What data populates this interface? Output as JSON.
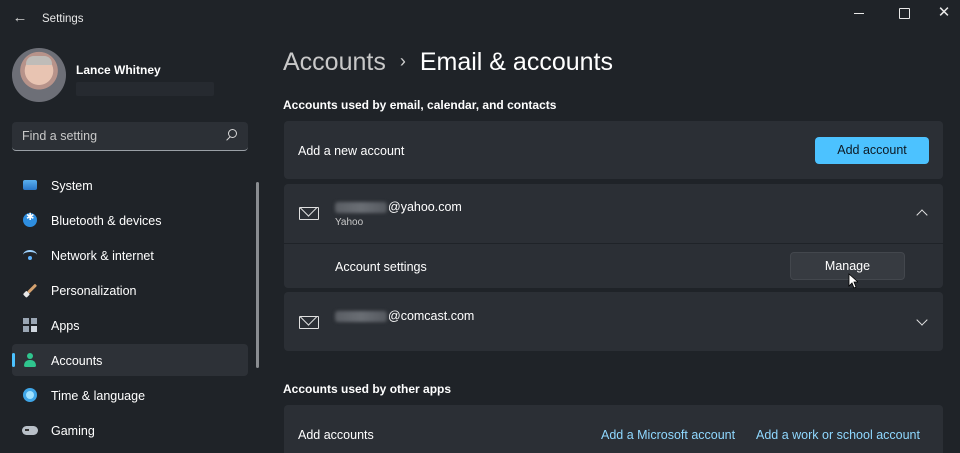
{
  "window": {
    "title": "Settings",
    "back_icon": "back-arrow-icon",
    "controls": [
      "minimize-icon",
      "maximize-icon",
      "close-icon"
    ]
  },
  "user": {
    "name": "Lance Whitney"
  },
  "search": {
    "placeholder": "Find a setting"
  },
  "sidebar": {
    "items": [
      {
        "label": "System",
        "icon": "system-icon"
      },
      {
        "label": "Bluetooth & devices",
        "icon": "bluetooth-icon"
      },
      {
        "label": "Network & internet",
        "icon": "wifi-icon"
      },
      {
        "label": "Personalization",
        "icon": "brush-icon"
      },
      {
        "label": "Apps",
        "icon": "apps-icon"
      },
      {
        "label": "Accounts",
        "icon": "person-icon",
        "active": true
      },
      {
        "label": "Time & language",
        "icon": "globe-clock-icon"
      },
      {
        "label": "Gaming",
        "icon": "controller-icon"
      }
    ]
  },
  "breadcrumb": {
    "parent": "Accounts",
    "separator": "›",
    "current": "Email & accounts"
  },
  "email_section": {
    "heading": "Accounts used by email, calendar, and contacts",
    "add_row": {
      "label": "Add a new account",
      "button": "Add account"
    },
    "accounts": [
      {
        "email_suffix": "@yahoo.com",
        "provider": "Yahoo",
        "expanded": true,
        "settings_label": "Account settings",
        "manage_button": "Manage"
      },
      {
        "email_suffix": "@comcast.com",
        "expanded": false
      }
    ]
  },
  "other_apps_section": {
    "heading": "Accounts used by other apps",
    "row": {
      "label": "Add accounts",
      "link_microsoft": "Add a Microsoft account",
      "link_work": "Add a work or school account"
    }
  },
  "colors": {
    "background": "#1f2328",
    "card": "#2b2f35",
    "accent": "#4cc2ff",
    "link": "#8fd8ff"
  }
}
